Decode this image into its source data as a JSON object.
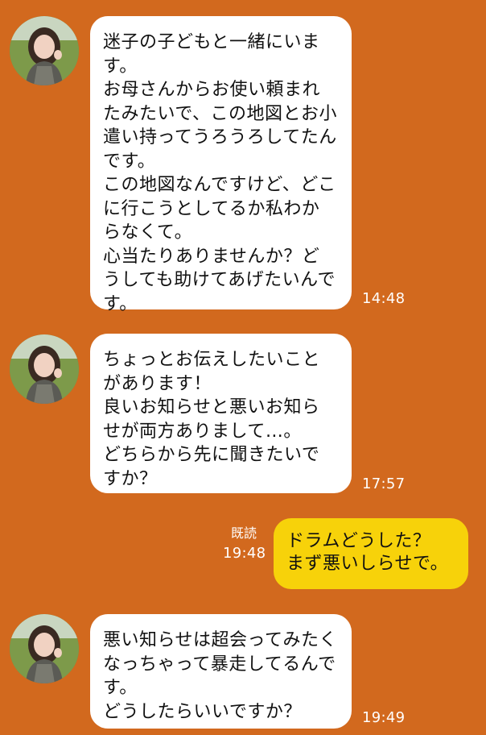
{
  "messages": [
    {
      "type": "received",
      "text": "迷子の子どもと一緒にいます。\nお母さんからお使い頼まれたみたいで、この地図とお小遣い持ってうろうろしてたんです。\nこの地図なんですけど、どこに行こうとしてるか私わからなくて。\n心当たりありませんか？どうしても助けてあげたいんです。",
      "time": "14:48"
    },
    {
      "type": "received",
      "text": "ちょっとお伝えしたいことがあります！\n良いお知らせと悪いお知らせが両方ありまして…。\nどちらから先に聞きたいですか？",
      "time": "17:57"
    },
    {
      "type": "sent",
      "text": "ドラムどうした？\nまず悪いしらせで。",
      "read_label": "既読",
      "time": "19:48"
    },
    {
      "type": "received",
      "text": "悪い知らせは超会ってみたくなっちゃって暴走してるんです。\nどうしたらいいですか？",
      "time": "19:49"
    }
  ],
  "colors": {
    "background": "#D2691E",
    "received_bubble": "#FFFFFF",
    "sent_bubble": "#F7D20A",
    "timestamp": "#FFFFFF"
  },
  "icons": {
    "avatar": "contact-avatar-photo"
  }
}
